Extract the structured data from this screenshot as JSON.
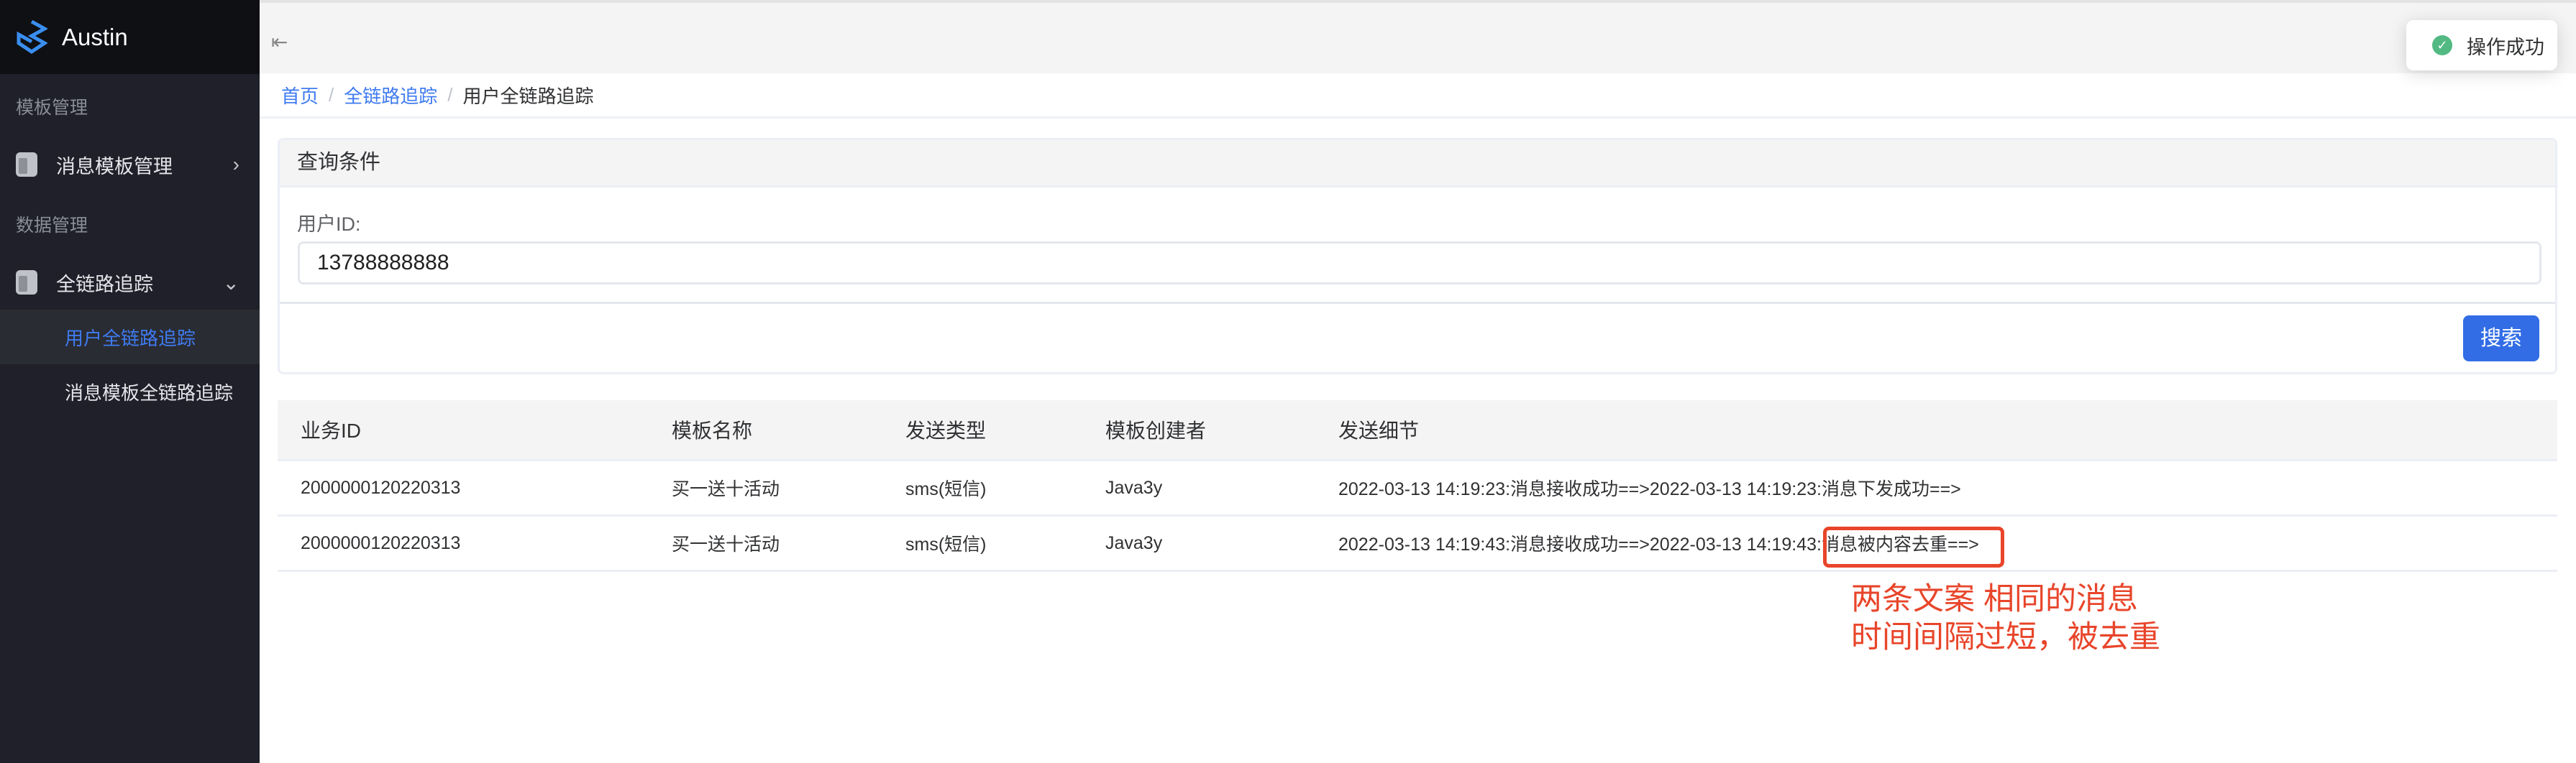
{
  "app": {
    "title": "Austin"
  },
  "sidebar": {
    "groups": [
      {
        "label": "模板管理"
      },
      {
        "label": "数据管理"
      }
    ],
    "menus": [
      {
        "label": "消息模板管理"
      },
      {
        "label": "全链路追踪"
      }
    ],
    "subs": [
      {
        "label": "用户全链路追踪"
      },
      {
        "label": "消息模板全链路追踪"
      }
    ]
  },
  "breadcrumb": [
    "首页",
    "全链路追踪",
    "用户全链路追踪"
  ],
  "query": {
    "title": "查询条件",
    "user_id_label": "用户ID:",
    "user_id_value": "13788888888",
    "search_label": "搜索"
  },
  "table": {
    "headers": [
      "业务ID",
      "模板名称",
      "发送类型",
      "模板创建者",
      "发送细节"
    ],
    "rows": [
      [
        "2000000120220313",
        "买一送十活动",
        "sms(短信)",
        "Java3y",
        "2022-03-13 14:19:23:消息接收成功==>2022-03-13 14:19:23:消息下发成功==>"
      ],
      [
        "2000000120220313",
        "买一送十活动",
        "sms(短信)",
        "Java3y",
        "2022-03-13 14:19:43:消息接收成功==>2022-03-13 14:19:43:消息被内容去重==>"
      ]
    ]
  },
  "annotation": {
    "line1": "两条文案 相同的消息",
    "line2": "时间间隔过短，被去重",
    "color": "#e8452a"
  },
  "toast": {
    "message": "操作成功",
    "status": "success"
  },
  "colors": {
    "accent": "#326de6",
    "sidebar": "#1f2029"
  }
}
